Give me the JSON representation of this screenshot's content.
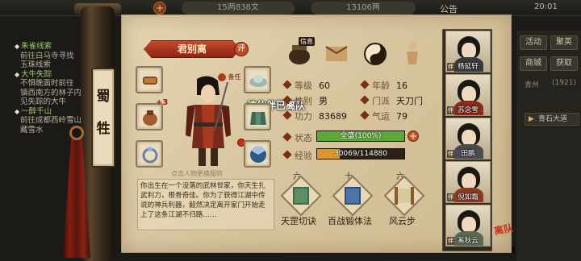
{
  "hud": {
    "res1": "15两838文",
    "res2": "13106两",
    "notice": "公告",
    "time": "20:01"
  },
  "quests": [
    {
      "title": "朱雀线索",
      "desc": [
        "前往白马寺寻找",
        "玉珠线索"
      ]
    },
    {
      "title": "大牛失踪",
      "desc": [
        "不惧晚面时前往",
        "镇西南方的林子内",
        "见失踪的大牛"
      ]
    },
    {
      "title": "一醉千山",
      "desc": [
        "前往成都西岭雪山",
        "藏雪水"
      ]
    }
  ],
  "right_menu": {
    "btn1": "活动",
    "btn2": "聚英",
    "btn3": "商城",
    "btn4": "获取",
    "loc": "青州",
    "coords": "(1921)",
    "goto": "青石大道"
  },
  "section_tab": "蜀 牲",
  "character": {
    "name": "君别离",
    "eval_badge": "评",
    "role_mark": "备任",
    "slot_plus": "+3",
    "join_status": "该伙伴已离队",
    "change_hint": "点击人物更换服饰",
    "description": "你出生在一个没落的武林世家，你天生扎武利力，根骨奇佳。你为了获得江湖中传说的神兵利器，毅然决定离开家门开始走上了这条江湖不归路……"
  },
  "tokens": {
    "label": "信息"
  },
  "stats": {
    "level_label": "等级",
    "level": "60",
    "age_label": "年龄",
    "age": "16",
    "gender_label": "性别",
    "gender": "男",
    "sect_label": "门派",
    "sect": "天刀门",
    "power_label": "功力",
    "power": "83689",
    "luck_label": "气运",
    "luck": "79",
    "state_label": "状态",
    "state_text": "全盛(100%)",
    "state_pct": 100,
    "exp_label": "经验",
    "exp_text": "30069/114880",
    "exp_pct": 26
  },
  "skills": [
    {
      "name": "天罡切诀",
      "level": "六"
    },
    {
      "name": "百战锻体法",
      "level": "十"
    },
    {
      "name": "风云步",
      "level": "六"
    }
  ],
  "team": [
    {
      "name": "杨延轩",
      "tag": "伴"
    },
    {
      "name": "苏念雪",
      "tag": "伴"
    },
    {
      "name": "田鹏",
      "tag": "伴"
    },
    {
      "name": "倪如霜",
      "tag": "伴"
    },
    {
      "name": "奚秋云",
      "tag": "伴"
    }
  ],
  "seal": "离队",
  "colors": {
    "state_fill": "#5ea83a",
    "exp_fill": "#d9972c",
    "banner": "#a8301a"
  }
}
